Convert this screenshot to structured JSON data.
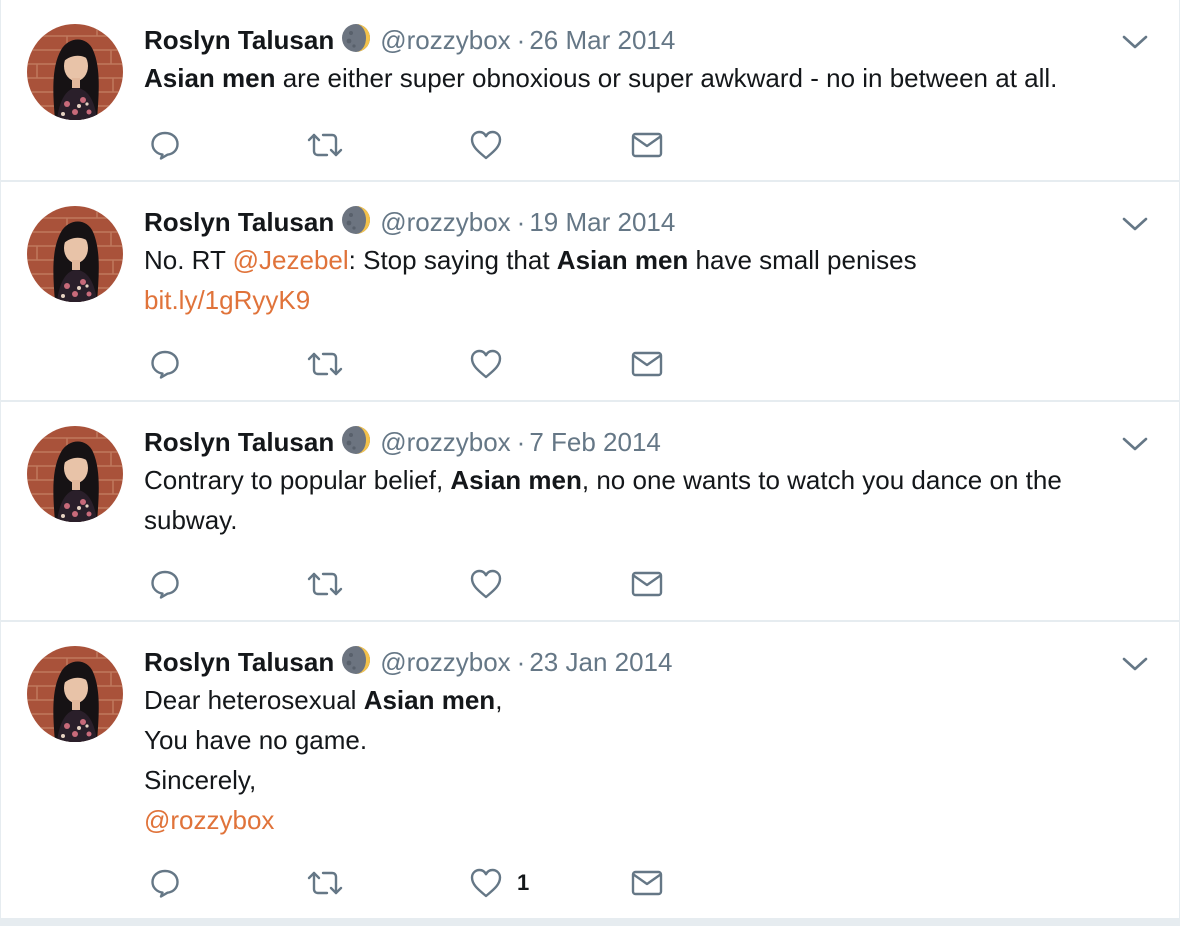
{
  "colors": {
    "text": "#14171a",
    "secondary": "#657786",
    "link": "#e0733a",
    "icon": "#657786",
    "divider": "#e6ecf0"
  },
  "tweets": [
    {
      "name": "Roslyn Talusan",
      "handle": "@rozzybox",
      "separator": "·",
      "date": "26 Mar 2014",
      "lines": [
        [
          {
            "text": "Asian men",
            "style": "bold"
          },
          {
            "text": " are either super obnoxious or super awkward - no in between at all.",
            "style": "normal"
          }
        ]
      ],
      "like_count": ""
    },
    {
      "name": "Roslyn Talusan",
      "handle": "@rozzybox",
      "separator": "·",
      "date": "19 Mar 2014",
      "lines": [
        [
          {
            "text": "No. RT ",
            "style": "normal"
          },
          {
            "text": "@Jezebel",
            "style": "link"
          },
          {
            "text": ": Stop saying that ",
            "style": "normal"
          },
          {
            "text": "Asian men",
            "style": "bold"
          },
          {
            "text": " have small penises",
            "style": "normal"
          }
        ],
        [
          {
            "text": "bit.ly/1gRyyK9",
            "style": "link"
          }
        ]
      ],
      "like_count": ""
    },
    {
      "name": "Roslyn Talusan",
      "handle": "@rozzybox",
      "separator": "·",
      "date": "7 Feb 2014",
      "lines": [
        [
          {
            "text": "Contrary to popular belief, ",
            "style": "normal"
          },
          {
            "text": "Asian men",
            "style": "bold"
          },
          {
            "text": ", no one wants to watch you dance on the",
            "style": "normal"
          }
        ],
        [
          {
            "text": "subway.",
            "style": "normal"
          }
        ]
      ],
      "like_count": ""
    },
    {
      "name": "Roslyn Talusan",
      "handle": "@rozzybox",
      "separator": "·",
      "date": "23 Jan 2014",
      "lines": [
        [
          {
            "text": "Dear heterosexual ",
            "style": "normal"
          },
          {
            "text": "Asian men",
            "style": "bold"
          },
          {
            "text": ",",
            "style": "normal"
          }
        ],
        [
          {
            "text": "You have no game.",
            "style": "normal"
          }
        ],
        [
          {
            "text": "Sincerely,",
            "style": "normal"
          }
        ],
        [
          {
            "text": "@rozzybox",
            "style": "link"
          }
        ]
      ],
      "like_count": "1"
    }
  ],
  "icons": {
    "badge": "crescent-moon-icon",
    "caret": "chevron-down-icon",
    "reply": "reply-bubble-icon",
    "retweet": "retweet-icon",
    "like": "heart-icon",
    "dm": "envelope-icon"
  }
}
